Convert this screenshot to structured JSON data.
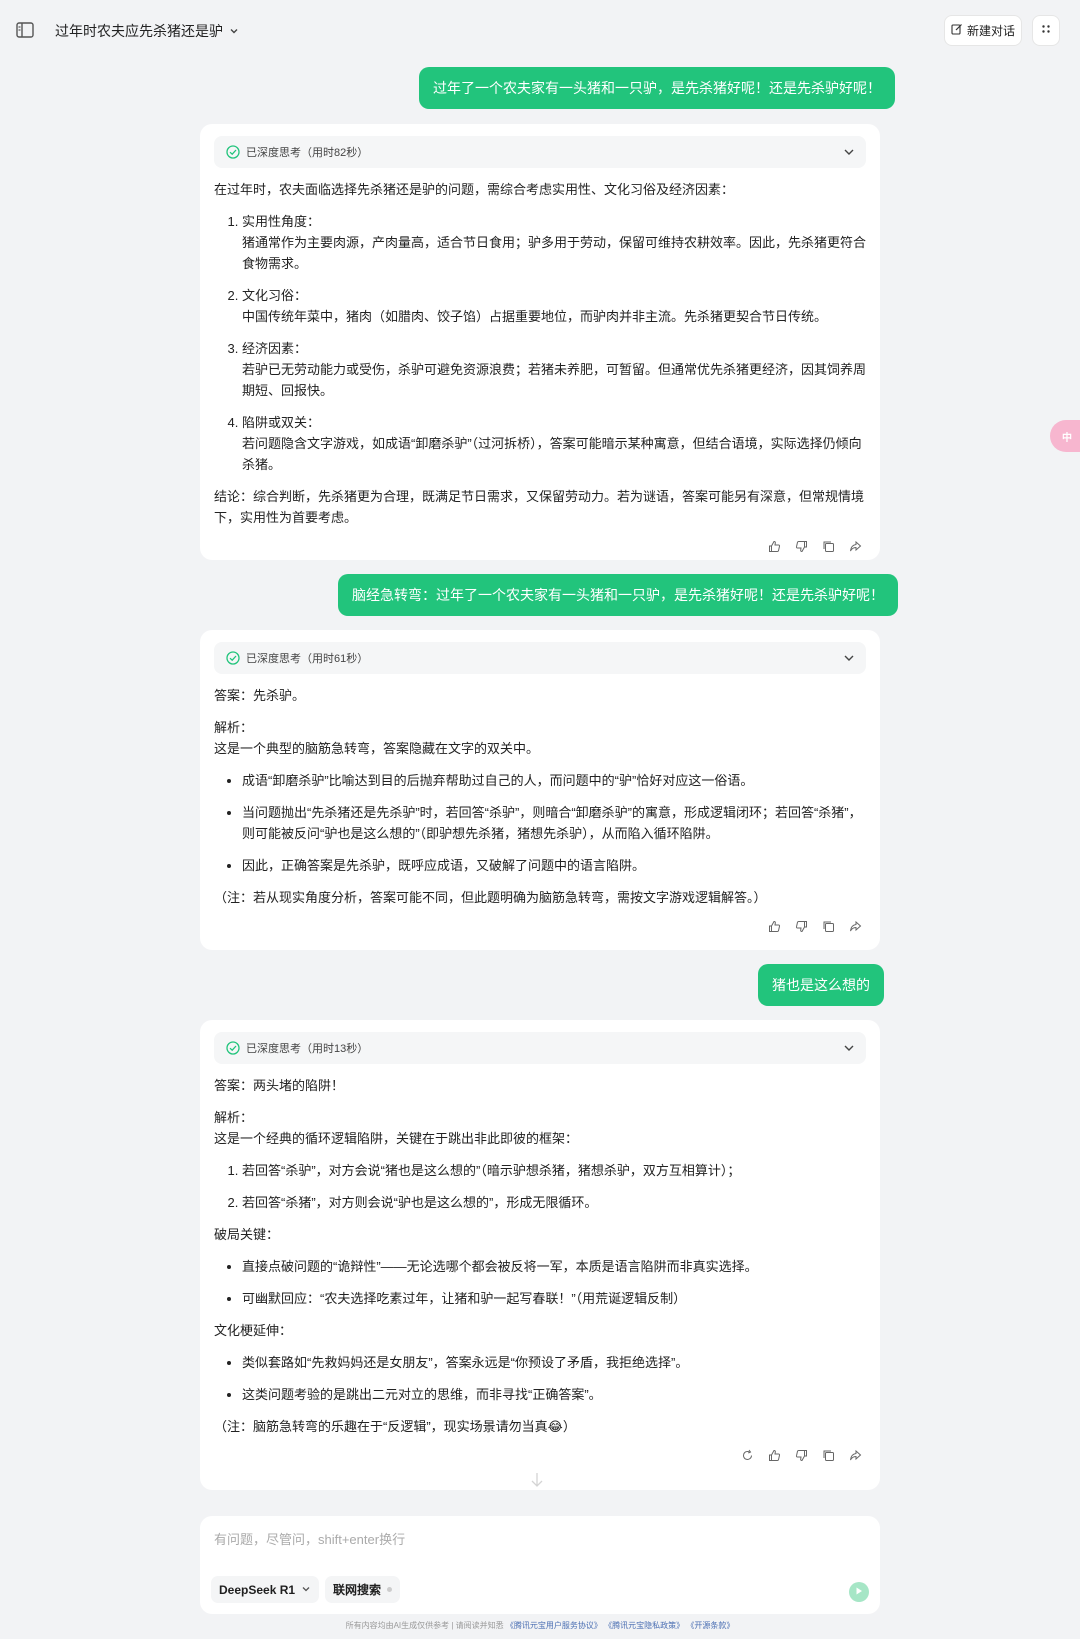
{
  "header": {
    "title": "过年时农夫应先杀猪还是驴",
    "new_chat_label": "新建对话"
  },
  "messages": {
    "user1": "过年了一个农夫家有一头猪和一只驴，是先杀猪好呢！还是先杀驴好呢！",
    "ai1": {
      "think": "已深度思考（用时82秒）",
      "intro": "在过年时，农夫面临选择先杀猪还是驴的问题，需综合考虑实用性、文化习俗及经济因素：",
      "items": [
        {
          "title": "实用性角度：",
          "body": "猪通常作为主要肉源，产肉量高，适合节日食用；驴多用于劳动，保留可维持农耕效率。因此，先杀猪更符合食物需求。"
        },
        {
          "title": "文化习俗：",
          "body": "中国传统年菜中，猪肉（如腊肉、饺子馅）占据重要地位，而驴肉并非主流。先杀猪更契合节日传统。"
        },
        {
          "title": "经济因素：",
          "body": "若驴已无劳动能力或受伤，杀驴可避免资源浪费；若猪未养肥，可暂留。但通常优先杀猪更经济，因其饲养周期短、回报快。"
        },
        {
          "title": "陷阱或双关：",
          "body": "若问题隐含文字游戏，如成语“卸磨杀驴”（过河拆桥），答案可能暗示某种寓意，但结合语境，实际选择仍倾向杀猪。"
        }
      ],
      "conclusion": "结论：综合判断，先杀猪更为合理，既满足节日需求，又保留劳动力。若为谜语，答案可能另有深意，但常规情境下，实用性为首要考虑。"
    },
    "user2": "脑经急转弯：过年了一个农夫家有一头猪和一只驴，是先杀猪好呢！还是先杀驴好呢！",
    "ai2": {
      "think": "已深度思考（用时61秒）",
      "answer": "答案：先杀驴。",
      "analysis_title": "解析：",
      "analysis_intro": "这是一个典型的脑筋急转弯，答案隐藏在文字的双关中。",
      "bullets": [
        "成语“卸磨杀驴”比喻达到目的后抛弃帮助过自己的人，而问题中的“驴”恰好对应这一俗语。",
        "当问题抛出“先杀猪还是先杀驴”时，若回答“杀驴”，则暗合“卸磨杀驴”的寓意，形成逻辑闭环；若回答“杀猪”，则可能被反问“驴也是这么想的”（即驴想先杀猪，猪想先杀驴），从而陷入循环陷阱。",
        "因此，正确答案是先杀驴，既呼应成语，又破解了问题中的语言陷阱。"
      ],
      "note": "（注：若从现实角度分析，答案可能不同，但此题明确为脑筋急转弯，需按文字游戏逻辑解答。）"
    },
    "user3": "猪也是这么想的",
    "ai3": {
      "think": "已深度思考（用时13秒）",
      "answer": "答案：两头堵的陷阱！",
      "analysis_title": "解析：",
      "analysis_intro": "这是一个经典的循环逻辑陷阱，关键在于跳出非此即彼的框架：",
      "ordered": [
        "若回答“杀驴”，对方会说“猪也是这么想的”（暗示驴想杀猪，猪想杀驴，双方互相算计）；",
        "若回答“杀猪”，对方则会说“驴也是这么想的”，形成无限循环。"
      ],
      "key_title": "破局关键：",
      "key_bullets": [
        "直接点破问题的“诡辩性”——无论选哪个都会被反将一军，本质是语言陷阱而非真实选择。",
        "可幽默回应：“农夫选择吃素过年，让猪和驴一起写春联！”（用荒诞逻辑反制）"
      ],
      "culture_title": "文化梗延伸：",
      "culture_bullets": [
        "类似套路如“先救妈妈还是女朋友”，答案永远是“你预设了矛盾，我拒绝选择”。",
        "这类问题考验的是跳出二元对立的思维，而非寻找“正确答案”。"
      ],
      "note": "（注：脑筋急转弯的乐趣在于“反逻辑”，现实场景请勿当真😂）"
    }
  },
  "side_float_label": "中",
  "composer": {
    "placeholder": "有问题，尽管问，shift+enter换行",
    "model": "DeepSeek R1",
    "search": "联网搜索"
  },
  "footer": {
    "text": "所有内容均由AI生成仅供参考 | 请阅读并知悉",
    "link1": "《腾讯元宝用户服务协议》",
    "link2": "《腾讯元宝隐私政策》",
    "link3": "《开源条款》"
  },
  "colors": {
    "accent": "#22c47c",
    "background": "#f2f3f5"
  }
}
